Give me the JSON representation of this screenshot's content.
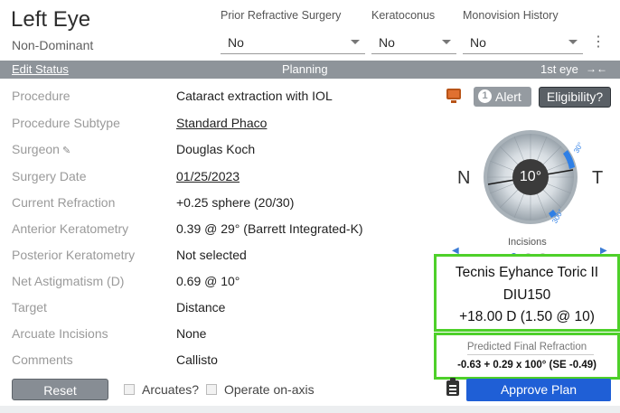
{
  "header": {
    "title": "Left Eye",
    "subtitle": "Non-Dominant",
    "dropdowns": [
      {
        "label": "Prior Refractive Surgery",
        "value": "No"
      },
      {
        "label": "Keratoconus",
        "value": "No"
      },
      {
        "label": "Monovision History",
        "value": "No"
      }
    ]
  },
  "status_bar": {
    "edit_label": "Edit Status",
    "status": "Planning",
    "eye_order": "1st eye",
    "swap_glyph": "→←"
  },
  "fields": [
    {
      "label": "Procedure",
      "value": "Cataract extraction with IOL"
    },
    {
      "label": "Procedure Subtype",
      "value": "Standard Phaco"
    },
    {
      "label": "Surgeon",
      "value": "Douglas Koch"
    },
    {
      "label": "Surgery Date",
      "value": "01/25/2023"
    },
    {
      "label": "Current Refraction",
      "value": "+0.25 sphere (20/30)"
    },
    {
      "label": "Anterior Keratometry",
      "value": "0.39 @ 29° (Barrett Integrated-K)"
    },
    {
      "label": "Posterior Keratometry",
      "value": "Not selected"
    },
    {
      "label": "Net Astigmatism (D)",
      "value": "0.69 @ 10°"
    },
    {
      "label": "Target",
      "value": "Distance"
    },
    {
      "label": "Arcuate Incisions",
      "value": "None"
    },
    {
      "label": "Comments",
      "value": "Callisto"
    }
  ],
  "actions": {
    "alert_count": "1",
    "alert_label": "Alert",
    "eligibility_label": "Eligibility?"
  },
  "dial": {
    "nasal": "N",
    "temporal": "T",
    "axis": "10°",
    "incision_top": "30°",
    "incision_bottom": "300°",
    "incisions_label": "Incisions"
  },
  "lens": {
    "name": "Tecnis Eyhance Toric II",
    "model": "DIU150",
    "power": "+18.00 D (1.50 @ 10)"
  },
  "prediction": {
    "label": "Predicted Final Refraction",
    "value": "-0.63 + 0.29 x 100° (SE -0.49)"
  },
  "footer": {
    "reset_label": "Reset",
    "arcuates_label": "Arcuates?",
    "operate_label": "Operate on-axis",
    "approve_label": "Approve Plan"
  },
  "colors": {
    "primary": "#1f5fd6",
    "highlight_border": "#4ed02a",
    "status_bar": "#8e949a",
    "incision_marker": "#3a7bd5"
  }
}
